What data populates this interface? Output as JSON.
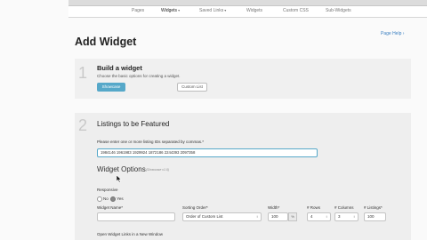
{
  "nav": {
    "items": [
      {
        "label": "Pages",
        "dropdown": false,
        "active": false
      },
      {
        "label": "Widgets",
        "dropdown": true,
        "active": true
      },
      {
        "label": "Saved Links",
        "dropdown": true,
        "active": false
      },
      {
        "label": "Widgets",
        "dropdown": false,
        "active": false
      },
      {
        "label": "Custom CSS",
        "dropdown": false,
        "active": false
      },
      {
        "label": "Sub-Widgets",
        "dropdown": false,
        "active": false
      }
    ]
  },
  "page_help": "Page Help",
  "page_title": "Add Widget",
  "step1": {
    "number": "1",
    "title": "Build a widget",
    "description": "Choose the basic options for creating a widget.",
    "primary_button": "Showcase",
    "secondary_button": "Custom List"
  },
  "step2": {
    "number": "2",
    "title": "Listings to be Featured",
    "ids_label": "Please enter one or more listing IDs separated by commas.*",
    "ids_value": "1984146 1961983 1929924 1872186 2244393 2097358",
    "widget_options_title": "Widget Options",
    "widget_options_version": "(Showcase v1.0)",
    "responsive_label": "Responsive",
    "responsive_no": "No",
    "responsive_yes": "Yes",
    "fields": {
      "widget_name_label": "Widget Name*",
      "widget_name_value": "",
      "sorting_order_label": "Sorting Order*",
      "sorting_order_value": "Order of Custom List",
      "width_label": "Width*",
      "width_value": "100",
      "width_unit": "%",
      "rows_label": "# Rows",
      "rows_value": "4",
      "columns_label": "# Columns",
      "columns_value": "3",
      "listings_label": "# Listings*",
      "listings_value": "100"
    },
    "open_links_label": "Open Widget Links in a New Window"
  },
  "colors": {
    "accent": "#56a8c9",
    "link": "#3a7fc1",
    "panel": "#f0f0f0"
  }
}
